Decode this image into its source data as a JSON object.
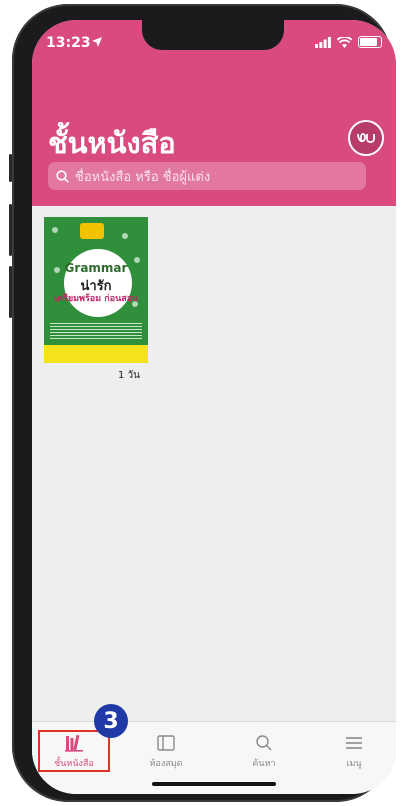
{
  "status_bar": {
    "time": "13:23"
  },
  "header": {
    "title": "ชั้นหนังสือ",
    "search_placeholder": "ชื่อหนังสือ หรือ ชื่อผู้แต่ง",
    "accent_color": "#d94a7f"
  },
  "bookshelf": {
    "books": [
      {
        "cover_title_line1": "Grammar",
        "cover_title_line2": "น่ารัก",
        "cover_title_line3": "เตรียมพร้อม ก่อนสอบ",
        "remaining": "1 วัน"
      }
    ]
  },
  "tabbar": {
    "step_number": "3",
    "tabs": [
      {
        "label": "ชั้นหนังสือ",
        "icon": "bookshelf-icon",
        "active": true
      },
      {
        "label": "ห้องสมุด",
        "icon": "library-icon",
        "active": false
      },
      {
        "label": "ค้นหา",
        "icon": "search-icon",
        "active": false
      },
      {
        "label": "เมนู",
        "icon": "menu-icon",
        "active": false
      }
    ],
    "highlight_color": "#e3322b",
    "badge_color": "#1f3aa6"
  }
}
